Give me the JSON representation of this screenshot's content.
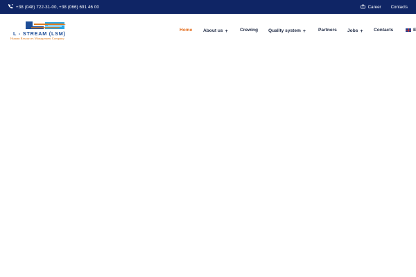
{
  "topbar": {
    "phone": "+38 (048) 722-31-00, +38 (066) 691 46 00",
    "career_label": "Career",
    "contacts_label": "Contacts",
    "icons": {
      "phone": "phone-icon",
      "career": "briefcase-icon"
    }
  },
  "logo": {
    "wordmark": "L - STREAM (LSM)",
    "tagline": "Human Resources Management Company",
    "colors": {
      "blue": "#1d4d97",
      "orange": "#e07b1e",
      "cyan": "#2aa6e3"
    }
  },
  "nav": {
    "items": [
      {
        "label": "Home",
        "active": true
      },
      {
        "label": "About us",
        "has_submenu": true
      },
      {
        "label": "Crewing"
      },
      {
        "label": "Quality system",
        "has_submenu": true
      },
      {
        "label": "Partners"
      },
      {
        "label": "Jobs",
        "has_submenu": true
      },
      {
        "label": "Contacts"
      }
    ],
    "language": "En",
    "submenu_marker": "+"
  },
  "colors": {
    "topbar_bg": "#0f2565",
    "accent": "#e36d1e",
    "nav_text": "#1f2a44"
  }
}
